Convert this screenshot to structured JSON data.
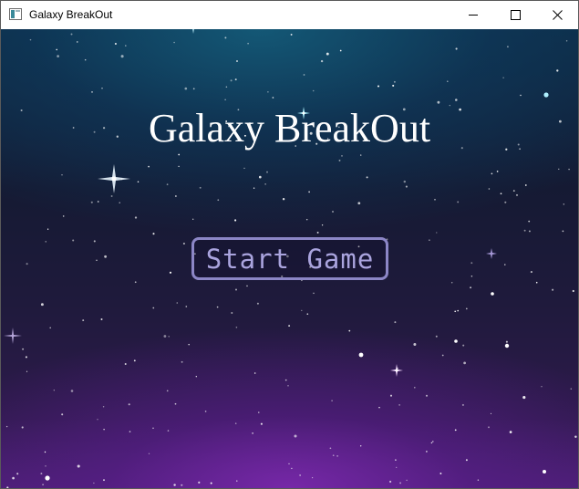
{
  "window": {
    "title": "Galaxy BreakOut",
    "controls": {
      "minimize_icon": "minimize-icon",
      "maximize_icon": "maximize-icon",
      "close_icon": "close-icon"
    }
  },
  "game": {
    "title": "Galaxy BreakOut",
    "start_button_label": "Start Game"
  },
  "colors": {
    "title_text": "#ffffff",
    "button_border": "#8c86c6",
    "button_text": "#aaa4de",
    "sky_top": "#0c2a44",
    "sky_bottom": "#4a1f72"
  }
}
